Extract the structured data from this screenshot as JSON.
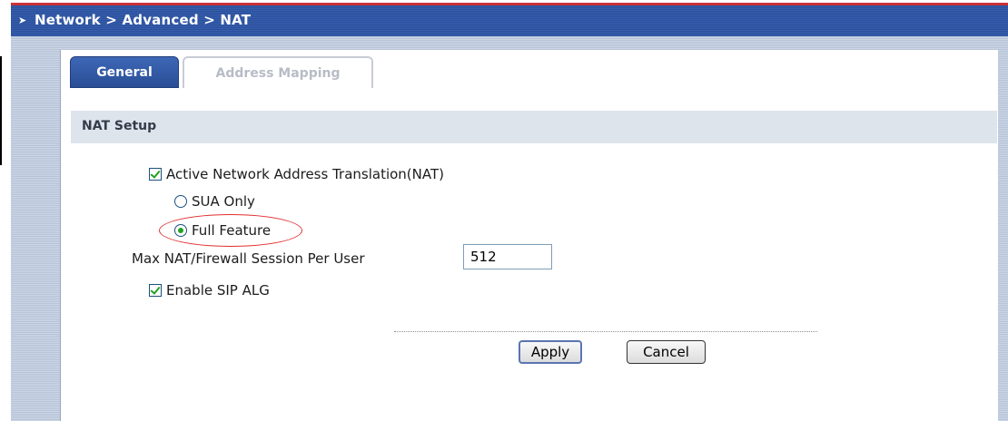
{
  "header": {
    "breadcrumb_arrow": "➤",
    "title": "Network > Advanced > NAT"
  },
  "tabs": [
    {
      "label": "General",
      "active": true
    },
    {
      "label": "Address Mapping",
      "active": false
    }
  ],
  "section": {
    "title": "NAT Setup"
  },
  "form": {
    "active_nat": {
      "label": "Active Network Address Translation(NAT)",
      "checked": true
    },
    "sua_only": {
      "label": "SUA Only",
      "selected": false
    },
    "full_feature": {
      "label": "Full Feature",
      "selected": true
    },
    "max_session": {
      "label": "Max NAT/Firewall Session Per User",
      "value": "512"
    },
    "enable_sip_alg": {
      "label": "Enable SIP ALG",
      "checked": true
    }
  },
  "buttons": {
    "apply": "Apply",
    "cancel": "Cancel"
  },
  "colors": {
    "titlebar": "#2a4f9b",
    "active_tab": "#2a4e96",
    "checkmark": "#21a121",
    "annotation": "#e03030"
  }
}
